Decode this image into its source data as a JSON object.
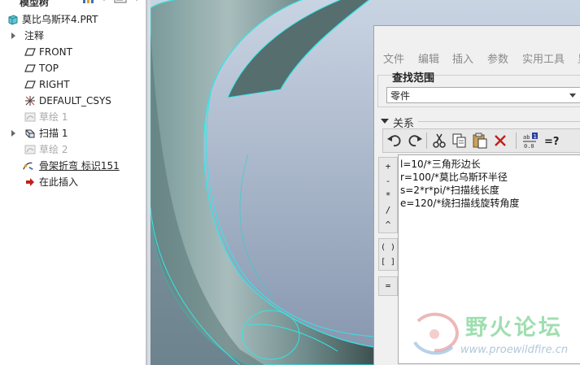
{
  "model_tree": {
    "header_title": "模型树",
    "root": "莫比乌斯环4.PRT",
    "items": [
      {
        "label": "注释",
        "state": "normal",
        "icon": "annotation-arrow"
      },
      {
        "label": "FRONT",
        "state": "normal",
        "icon": "datum-plane-icon"
      },
      {
        "label": "TOP",
        "state": "normal",
        "icon": "datum-plane-icon"
      },
      {
        "label": "RIGHT",
        "state": "normal",
        "icon": "datum-plane-icon"
      },
      {
        "label": "DEFAULT_CSYS",
        "state": "normal",
        "icon": "csys-icon"
      },
      {
        "label": "草绘 1",
        "state": "disabled",
        "icon": "sketch-icon"
      },
      {
        "label": "扫描 1",
        "state": "normal",
        "icon": "sweep-icon"
      },
      {
        "label": "草绘 2",
        "state": "disabled",
        "icon": "sketch-icon"
      },
      {
        "label": "骨架折弯 标识151",
        "state": "underlined",
        "icon": "spinal-bend-icon"
      },
      {
        "label": "在此插入",
        "state": "normal",
        "icon": "insert-here-icon"
      }
    ]
  },
  "relations_dialog": {
    "menu": [
      "文件",
      "编辑",
      "插入",
      "参数",
      "实用工具",
      "显"
    ],
    "scope_title": "查找范围",
    "scope_value": "零件",
    "section_label": "关系",
    "toolbar": [
      "undo-icon",
      "redo-icon",
      "cut-icon",
      "copy-icon",
      "paste-icon",
      "delete-icon",
      "evaluate-icon",
      "verify-icon"
    ],
    "operators": [
      "+",
      "-",
      "*",
      "/",
      "^",
      "( )",
      "[ ]",
      "="
    ],
    "lines": [
      "l=10/*三角形边长",
      "r=100/*莫比乌斯环半径",
      "s=2*r*pi/*扫描线长度",
      "e=120/*绕扫描线旋转角度"
    ]
  },
  "watermark": {
    "text": "野火论坛",
    "url": "www.proewildfire.cn"
  },
  "colors": {
    "viewport_top": "#c8d3e2",
    "viewport_bottom": "#8696ae",
    "model_edge": "#33e6e6",
    "model_surface": "#8aa6a6"
  }
}
